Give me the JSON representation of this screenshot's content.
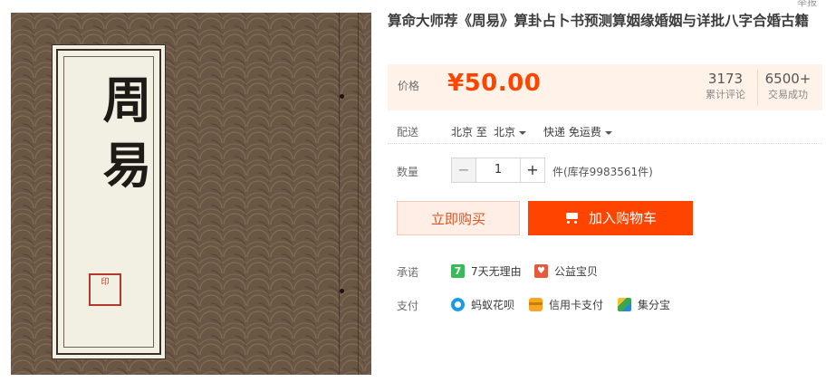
{
  "product": {
    "title": "算命大师荐《周易》算卦占卜书预测算姻缘婚姻与详批八字合婚古籍",
    "image_title": "周易",
    "seal_text": "印",
    "top_tip": "举报"
  },
  "price": {
    "label": "价格",
    "value": "¥50.00"
  },
  "stats": [
    {
      "num": "3173",
      "caption": "累计评论"
    },
    {
      "num": "6500+",
      "caption": "交易成功"
    }
  ],
  "shipping": {
    "label": "配送",
    "from": "北京 至",
    "to": "北京",
    "method": "快递 免运费"
  },
  "quantity": {
    "label": "数量",
    "minus": "−",
    "value": "1",
    "plus": "+",
    "stock": "件(库存9983561件)"
  },
  "buttons": {
    "buy_now": "立即购买",
    "add_to_cart": "加入购物车"
  },
  "promise": {
    "label": "承诺",
    "items": [
      {
        "icon": "seven-days-icon",
        "glyph": "7",
        "text": "7天无理由"
      },
      {
        "icon": "charity-icon",
        "text": "公益宝贝"
      }
    ]
  },
  "payment": {
    "label": "支付",
    "items": [
      {
        "icon": "huabei-icon",
        "text": "蚂蚁花呗"
      },
      {
        "icon": "credit-card-icon",
        "text": "信用卡支付"
      },
      {
        "icon": "jifenbao-icon",
        "text": "集分宝"
      }
    ]
  },
  "colors": {
    "accent": "#ff4400",
    "price_bg": "#fff2e8",
    "buy_bg": "#ffeee5"
  }
}
